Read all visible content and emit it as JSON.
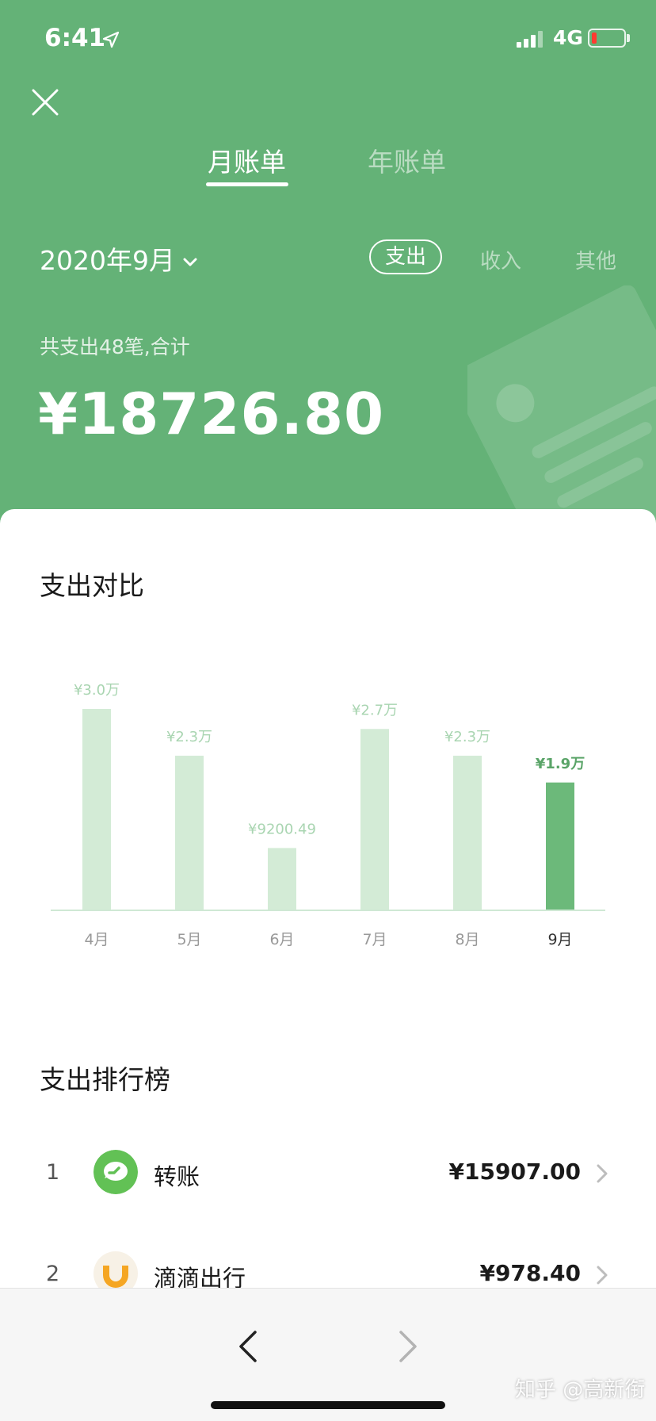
{
  "status_bar": {
    "time": "6:41",
    "network": "4G"
  },
  "tabs": [
    {
      "label": "月账单",
      "active": true
    },
    {
      "label": "年账单",
      "active": false
    }
  ],
  "filter": {
    "month": "2020年9月",
    "options": [
      {
        "label": "支出",
        "selected": true
      },
      {
        "label": "收入",
        "selected": false
      },
      {
        "label": "其他",
        "selected": false
      }
    ]
  },
  "summary": {
    "text": "共支出48笔,合计",
    "amount": "¥18726.80"
  },
  "chart_section": {
    "title": "支出对比"
  },
  "chart_data": {
    "type": "bar",
    "categories": [
      "4月",
      "5月",
      "6月",
      "7月",
      "8月",
      "9月"
    ],
    "values": [
      30000,
      23000,
      9200.49,
      27000,
      23000,
      19000
    ],
    "data_labels": [
      "¥3.0万",
      "¥2.3万",
      "¥9200.49",
      "¥2.7万",
      "¥2.3万",
      "¥1.9万"
    ],
    "highlight_index": 5,
    "ylim": [
      0,
      30000
    ],
    "colors": {
      "bar": "#d3ebd6",
      "bar_highlight": "#6cb97a",
      "label": "#a9d5b1",
      "label_highlight": "#5aa468"
    }
  },
  "ranking": {
    "title": "支出排行榜",
    "items": [
      {
        "rank": "1",
        "name": "转账",
        "amount": "¥15907.00",
        "icon": "transfer-icon"
      },
      {
        "rank": "2",
        "name": "滴滴出行",
        "amount": "¥978.40",
        "icon": "didi-icon"
      }
    ]
  },
  "watermark": "知乎 @高新衔",
  "colors": {
    "header_bg": "#64b277",
    "accent": "#6cb97a"
  }
}
